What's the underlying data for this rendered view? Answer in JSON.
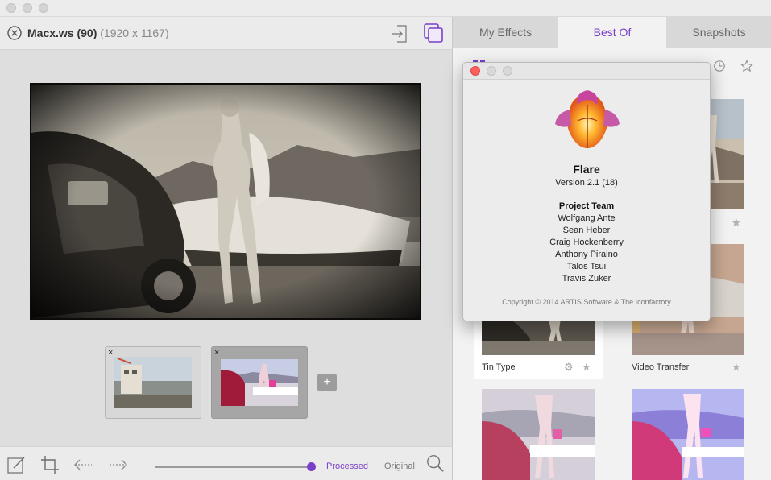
{
  "window": {
    "traffic_lights": [
      "close",
      "minimize",
      "zoom"
    ]
  },
  "document": {
    "name": "Macx.ws (90)",
    "dimensions": "(1920 x 1167)"
  },
  "thumbnails": {
    "remove_glyph": "×",
    "add_glyph": "+"
  },
  "bottom_bar": {
    "processed_label": "Processed",
    "original_label": "Original",
    "slider_value": 1.0
  },
  "tabs": [
    {
      "label": "My Effects",
      "active": false
    },
    {
      "label": "Best Of",
      "active": true
    },
    {
      "label": "Snapshots",
      "active": false
    }
  ],
  "effects": [
    {
      "name": "Tin Type",
      "selected": true
    },
    {
      "name": "Video Transfer",
      "selected": false
    }
  ],
  "about": {
    "app_name": "Flare",
    "version": "Version 2.1 (18)",
    "team_title": "Project Team",
    "team": [
      "Wolfgang Ante",
      "Sean Heber",
      "Craig Hockenberry",
      "Anthony Piraino",
      "Talos Tsui",
      "Travis Zuker"
    ],
    "copyright": "Copyright © 2014 ARTIS Software & The Iconfactory"
  },
  "colors": {
    "accent": "#7a3fc9",
    "close_red": "#fc605c",
    "inactive_light": "#d4d4d4"
  },
  "icons": {
    "close_doc": "close-circle-icon",
    "export": "export-icon",
    "compare": "compare-icon",
    "edit": "edit-icon",
    "crop": "crop-icon",
    "undo": "undo-icon",
    "redo": "redo-icon",
    "zoom": "zoom-icon",
    "grid": "grid-view-icon",
    "list": "list-view-icon",
    "menu": "menu-icon",
    "history": "clock-icon",
    "favorite": "star-icon",
    "settings": "gear-icon"
  }
}
